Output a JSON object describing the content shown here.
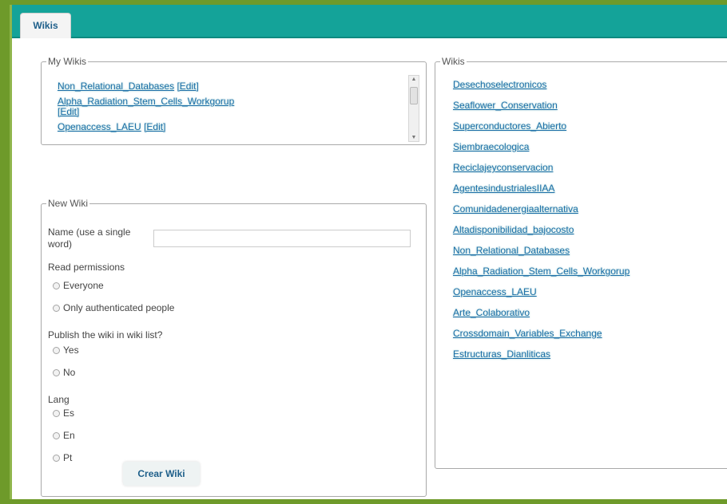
{
  "tab": {
    "label": "Wikis"
  },
  "my_wikis": {
    "legend": "My Wikis",
    "items": [
      {
        "name": "Non_Relational_Databases",
        "edit": "[Edit]"
      },
      {
        "name": "Alpha_Radiation_Stem_Cells_Workgorup",
        "edit": "[Edit]"
      },
      {
        "name": "Openaccess_LAEU",
        "edit": "[Edit]"
      }
    ]
  },
  "new_wiki": {
    "legend": "New Wiki",
    "name_label": "Name (use a single word)",
    "name_value": "",
    "read_permissions": {
      "label": "Read permissions",
      "options": [
        "Everyone",
        "Only authenticated people"
      ]
    },
    "publish": {
      "label": "Publish the wiki in wiki list?",
      "options": [
        "Yes",
        "No"
      ]
    },
    "lang": {
      "label": "Lang",
      "options": [
        "Es",
        "En",
        "Pt"
      ]
    },
    "submit_label": "Crear Wiki"
  },
  "wikis": {
    "legend": "Wikis",
    "items": [
      "Desechoselectronicos",
      "Seaflower_Conservation",
      "Superconductores_Abierto",
      "Siembraecologica",
      "Reciclajeyconservacion",
      "AgentesindustrialesIIAA",
      "Comunidadenergiaalternativa",
      "Altadisponibilidad_bajocosto",
      "Non_Relational_Databases",
      "Alpha_Radiation_Stem_Cells_Workgorup",
      "Openaccess_LAEU",
      "Arte_Colaborativo",
      "Crossdomain_Variables_Exchange",
      "Estructuras_Dianliticas"
    ]
  }
}
